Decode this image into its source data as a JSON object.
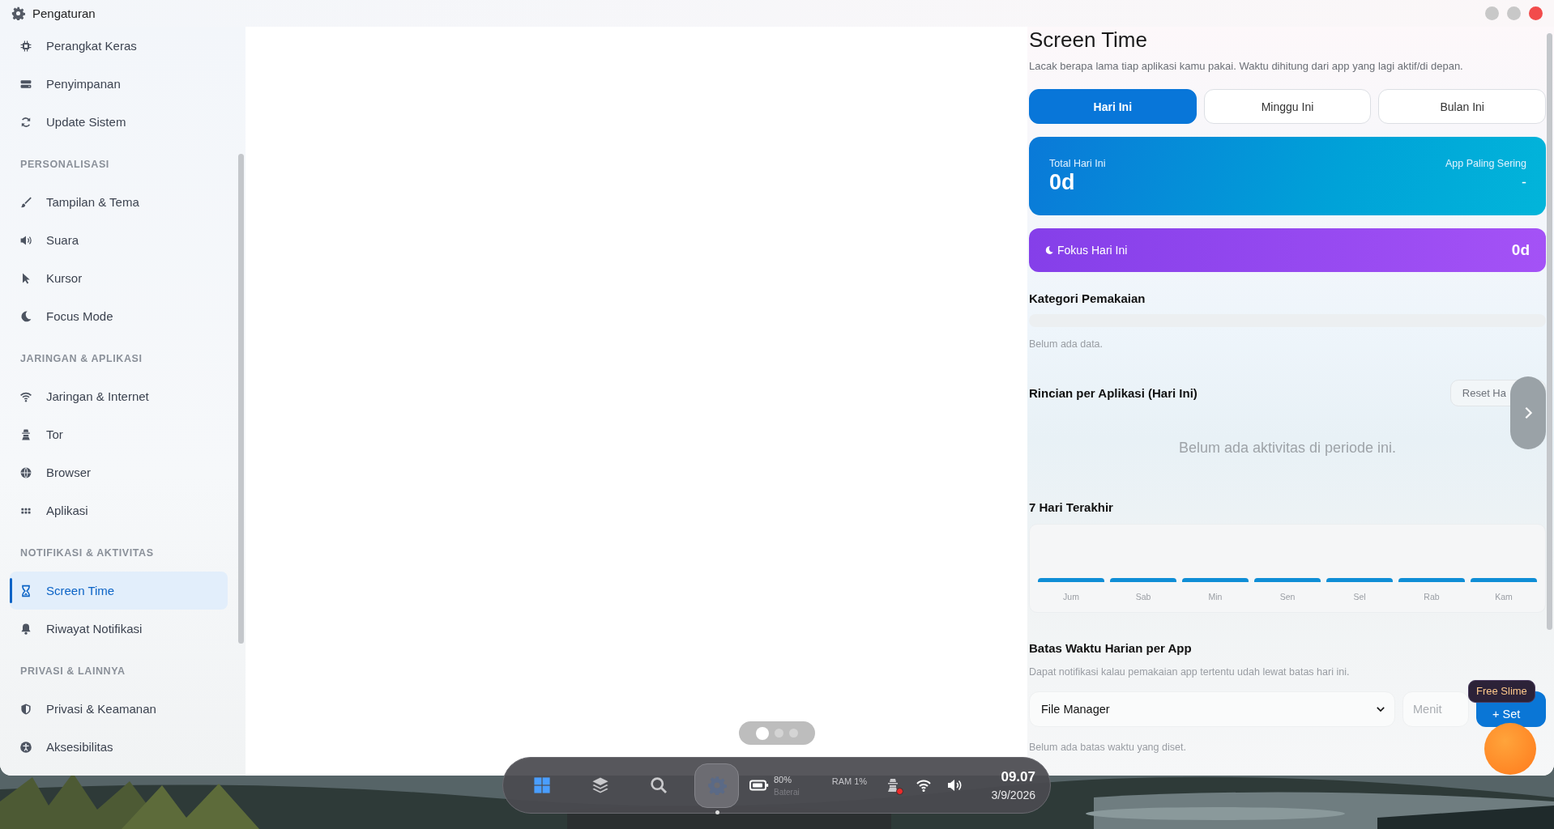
{
  "window": {
    "title": "Pengaturan"
  },
  "sidebar": {
    "sections": [
      {
        "items": [
          {
            "label": "Perangkat Keras",
            "selected": false
          },
          {
            "label": "Penyimpanan",
            "selected": false
          },
          {
            "label": "Update Sistem",
            "selected": false
          }
        ]
      },
      {
        "heading": "PERSONALISASI",
        "items": [
          {
            "label": "Tampilan & Tema",
            "selected": false
          },
          {
            "label": "Suara",
            "selected": false
          },
          {
            "label": "Kursor",
            "selected": false
          },
          {
            "label": "Focus Mode",
            "selected": false
          }
        ]
      },
      {
        "heading": "JARINGAN & APLIKASI",
        "items": [
          {
            "label": "Jaringan & Internet",
            "selected": false
          },
          {
            "label": "Tor",
            "selected": false
          },
          {
            "label": "Browser",
            "selected": false
          },
          {
            "label": "Aplikasi",
            "selected": false
          }
        ]
      },
      {
        "heading": "NOTIFIKASI & AKTIVITAS",
        "items": [
          {
            "label": "Screen Time",
            "selected": true
          },
          {
            "label": "Riwayat Notifikasi",
            "selected": false
          }
        ]
      },
      {
        "heading": "PRIVASI & LAINNYA",
        "items": [
          {
            "label": "Privasi & Keamanan",
            "selected": false
          },
          {
            "label": "Aksesibilitas",
            "selected": false
          }
        ]
      }
    ]
  },
  "screen_time": {
    "title": "Screen Time",
    "subtitle": "Lacak berapa lama tiap aplikasi kamu pakai. Waktu dihitung dari app yang lagi aktif/di depan.",
    "tabs": [
      {
        "label": "Hari Ini",
        "selected": true
      },
      {
        "label": "Minggu Ini",
        "selected": false
      },
      {
        "label": "Bulan Ini",
        "selected": false
      }
    ],
    "total": {
      "label": "Total Hari Ini",
      "value": "0d",
      "top_app_label": "App Paling Sering",
      "top_app_value": "-"
    },
    "focus": {
      "label": "Fokus Hari Ini",
      "value": "0d"
    },
    "category": {
      "heading": "Kategori Pemakaian",
      "empty": "Belum ada data."
    },
    "details": {
      "heading": "Rincian per Aplikasi (Hari Ini)",
      "reset_button": "Reset Ha",
      "empty": "Belum ada aktivitas di periode ini."
    },
    "last_7_days": {
      "heading": "7 Hari Terakhir",
      "days": [
        "Jum",
        "Sab",
        "Min",
        "Sen",
        "Sel",
        "Rab",
        "Kam"
      ]
    },
    "limits": {
      "heading": "Batas Waktu Harian per App",
      "description": "Dapat notifikasi kalau pemakaian app tertentu udah lewat batas hari ini.",
      "app_select": "File Manager",
      "minutes_placeholder": "Menit",
      "set_button": "+ Set",
      "empty": "Belum ada batas waktu yang diset."
    }
  },
  "tooltip": "Free Slime",
  "pager": {
    "dots": [
      {
        "selected": true
      },
      {
        "selected": false
      },
      {
        "selected": false
      }
    ]
  },
  "taskbar": {
    "apps": [
      {
        "selected": false
      },
      {
        "selected": false
      },
      {
        "selected": false
      },
      {
        "selected": true
      }
    ],
    "battery": {
      "percent": "80%",
      "label": "Baterai"
    },
    "ram": "RAM 1%",
    "tor_alert": true,
    "clock": {
      "time": "09.07",
      "date": "3/9/2026"
    }
  }
}
